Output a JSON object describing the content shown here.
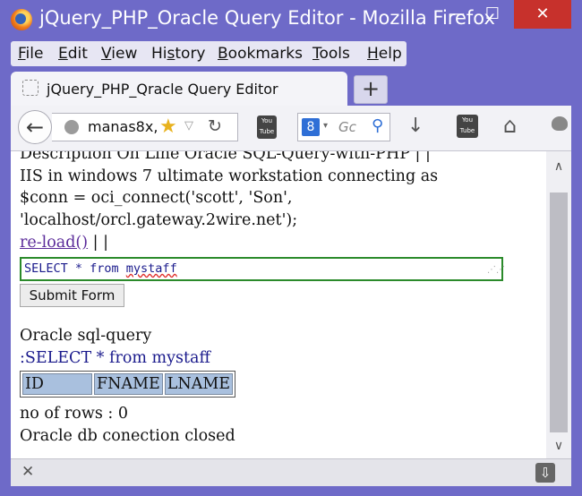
{
  "window": {
    "title": "jQuery_PHP_Oracle Query Editor - Mozilla Firefox",
    "min_glyph": "—",
    "max_glyph": "☐",
    "close_glyph": "✕"
  },
  "menu": {
    "items": [
      {
        "label": "File",
        "underline": "F",
        "rest": "ile"
      },
      {
        "label": "Edit",
        "underline": "E",
        "rest": "dit"
      },
      {
        "label": "View",
        "underline": "V",
        "rest": "iew"
      },
      {
        "label": "History",
        "pre": "Hi",
        "underline": "s",
        "rest": "tory"
      },
      {
        "label": "Bookmarks",
        "underline": "B",
        "rest": "ookmarks"
      },
      {
        "label": "Tools",
        "underline": "T",
        "rest": "ools"
      },
      {
        "label": "Help",
        "underline": "H",
        "rest": "elp"
      }
    ]
  },
  "tabs": [
    {
      "label": "jQuery_PHP_Qracle Query Editor"
    }
  ],
  "newtab_glyph": "+",
  "nav": {
    "back_glyph": "←",
    "url": "manas8x,",
    "star_glyph": "★",
    "drop_glyph": "▽",
    "reload_glyph": "↻",
    "yt_label": "You Tube",
    "search_engine_glyph": "8",
    "search_drop_glyph": "▾",
    "search_placeholder": "Gc",
    "search_glyph": "⚲",
    "download_glyph": "↓",
    "yt2_label": "You Tube",
    "home_glyph": "⌂"
  },
  "content": {
    "line1": "Description On Line Oracle SQL-Query-with-PHP | |",
    "line2": "IIS in windows 7 ultimate workstation connecting as",
    "line3": "$conn = oci_connect('scott', 'Son',",
    "line4": "'localhost/orcl.gateway.2wire.net');",
    "reload_link": "re-load()",
    "reload_suffix": " | |",
    "query_prefix": "SELECT * from ",
    "query_word": "mystaff",
    "submit_label": "Submit Form",
    "result_title": "Oracle sql-query",
    "result_query": ":SELECT * from mystaff",
    "table_headers": [
      "ID",
      "FNAME",
      "LNAME"
    ],
    "rows_label": "no of rows : 0",
    "closed_label": "Oracle db conection closed"
  },
  "scroll": {
    "up_glyph": "∧",
    "down_glyph": "∨"
  },
  "bottom": {
    "close_glyph": "✕",
    "download_glyph": "⇩"
  }
}
